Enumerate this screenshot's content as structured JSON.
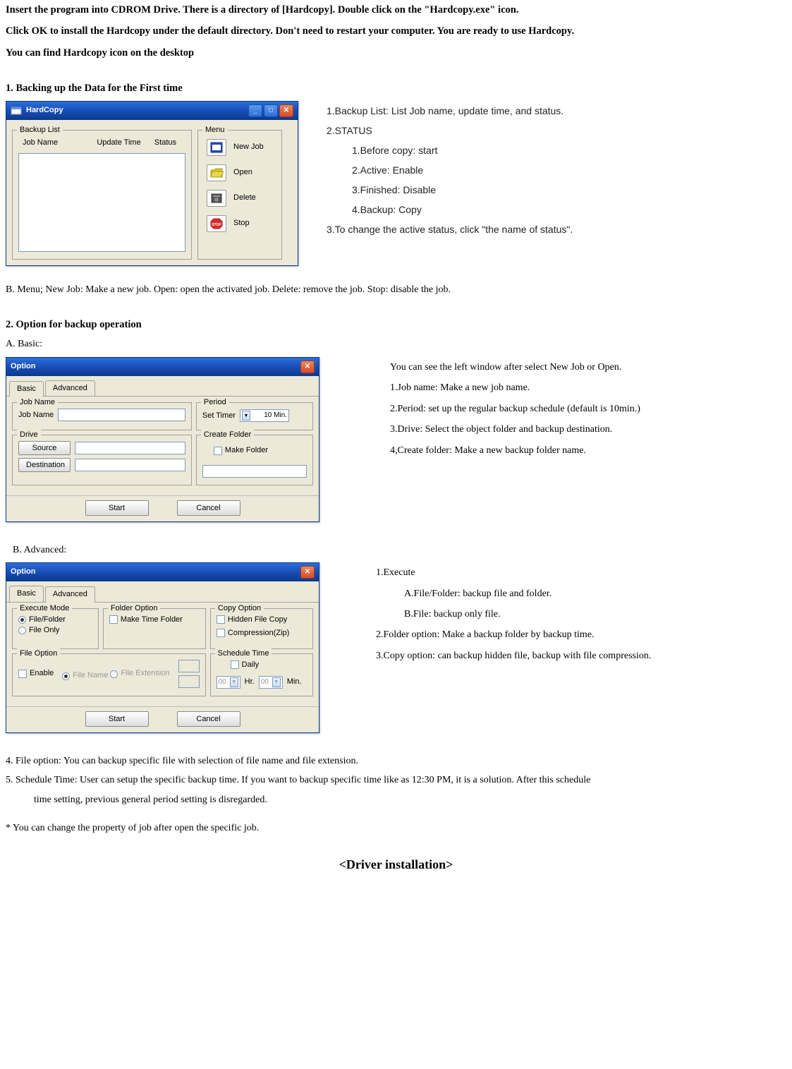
{
  "intro": {
    "p1": "Insert the program into CDROM Drive. There is a directory of [Hardcopy]. Double click on the \"Hardcopy.exe\" icon.",
    "p2": "Click OK to install the Hardcopy under the default directory. Don't need to restart your computer. You are ready to use Hardcopy.",
    "p3": "You can find Hardcopy icon on the desktop"
  },
  "s1": {
    "heading": "1. Backing up the Data for the First time",
    "win": {
      "title": "HardCopy",
      "backup_list_legend": "Backup List",
      "columns": {
        "c1": "Job Name",
        "c2": "Update Time",
        "c3": "Status"
      },
      "menu_legend": "Menu",
      "items": {
        "new": "New Job",
        "open": "Open",
        "delete": "Delete",
        "stop": "Stop"
      }
    },
    "annot": {
      "l1": "1.Backup List: List Job name, update time, and status.",
      "l2": "2.STATUS",
      "s1": "1.Before copy: start",
      "s2": "2.Active: Enable",
      "s3": "3.Finished: Disable",
      "s4": "4.Backup: Copy",
      "l3": "3.To change the active status, click \"the name of status\"."
    },
    "menu_desc": "B. Menu; New Job: Make a new job. Open: open the activated job. Delete: remove the job. Stop: disable the job."
  },
  "s2": {
    "heading": "2. Option for backup operation",
    "basic_label": "A. Basic:",
    "opt": {
      "title": "Option",
      "tab_basic": "Basic",
      "tab_adv": "Advanced",
      "jobname_g": "Job Name",
      "jobname_l": "Job Name",
      "period_g": "Period",
      "set_timer": "Set Timer",
      "timer_val": "10 Min.",
      "drive_g": "Drive",
      "source_btn": "Source",
      "dest_btn": "Destination",
      "createfolder_g": "Create Folder",
      "makefolder": "Make Folder",
      "start": "Start",
      "cancel": "Cancel"
    },
    "basic_annot": {
      "l0": "You can see the left window after select New Job or Open.",
      "l1": "1.Job name: Make a new job name.",
      "l2": "2.Period: set up the regular backup schedule (default is 10min.)",
      "l3": "3.Drive: Select the object folder and backup destination.",
      "l4": "4,Create folder: Make a new backup folder name."
    },
    "adv_label": "B. Advanced:",
    "adv": {
      "exec_g": "Execute Mode",
      "r1": "File/Folder",
      "r2": "File Only",
      "folder_g": "Folder Option",
      "maketf": "Make Time Folder",
      "copy_g": "Copy Option",
      "hidden": "Hidden File Copy",
      "zip": "Compression(Zip)",
      "fileopt_g": "File Option",
      "enable": "Enable",
      "fname": "File Name",
      "fext": "File Extension",
      "sched_g": "Schedule Time",
      "daily": "Daily",
      "hr": "Hr.",
      "min": "Min.",
      "zero": "00"
    },
    "adv_annot": {
      "l1": "1.Execute",
      "s1": "A.File/Folder: backup file and folder.",
      "s2": "B.File: backup only file.",
      "l2": "2.Folder option: Make a backup folder by backup time.",
      "l3": "3.Copy option: can backup hidden file, backup with file compression."
    }
  },
  "s3": {
    "p1": "4. File option: You can backup specific file with selection of file name and file extension.",
    "p2": "5. Schedule Time: User can setup the specific backup time. If you want to backup specific time like as 12:30 PM, it is a solution. After this schedule",
    "p2b": "time setting, previous general period setting is disregarded.",
    "p3": "* You can change the property of job after open the specific job."
  },
  "footer": "<Driver installation>"
}
